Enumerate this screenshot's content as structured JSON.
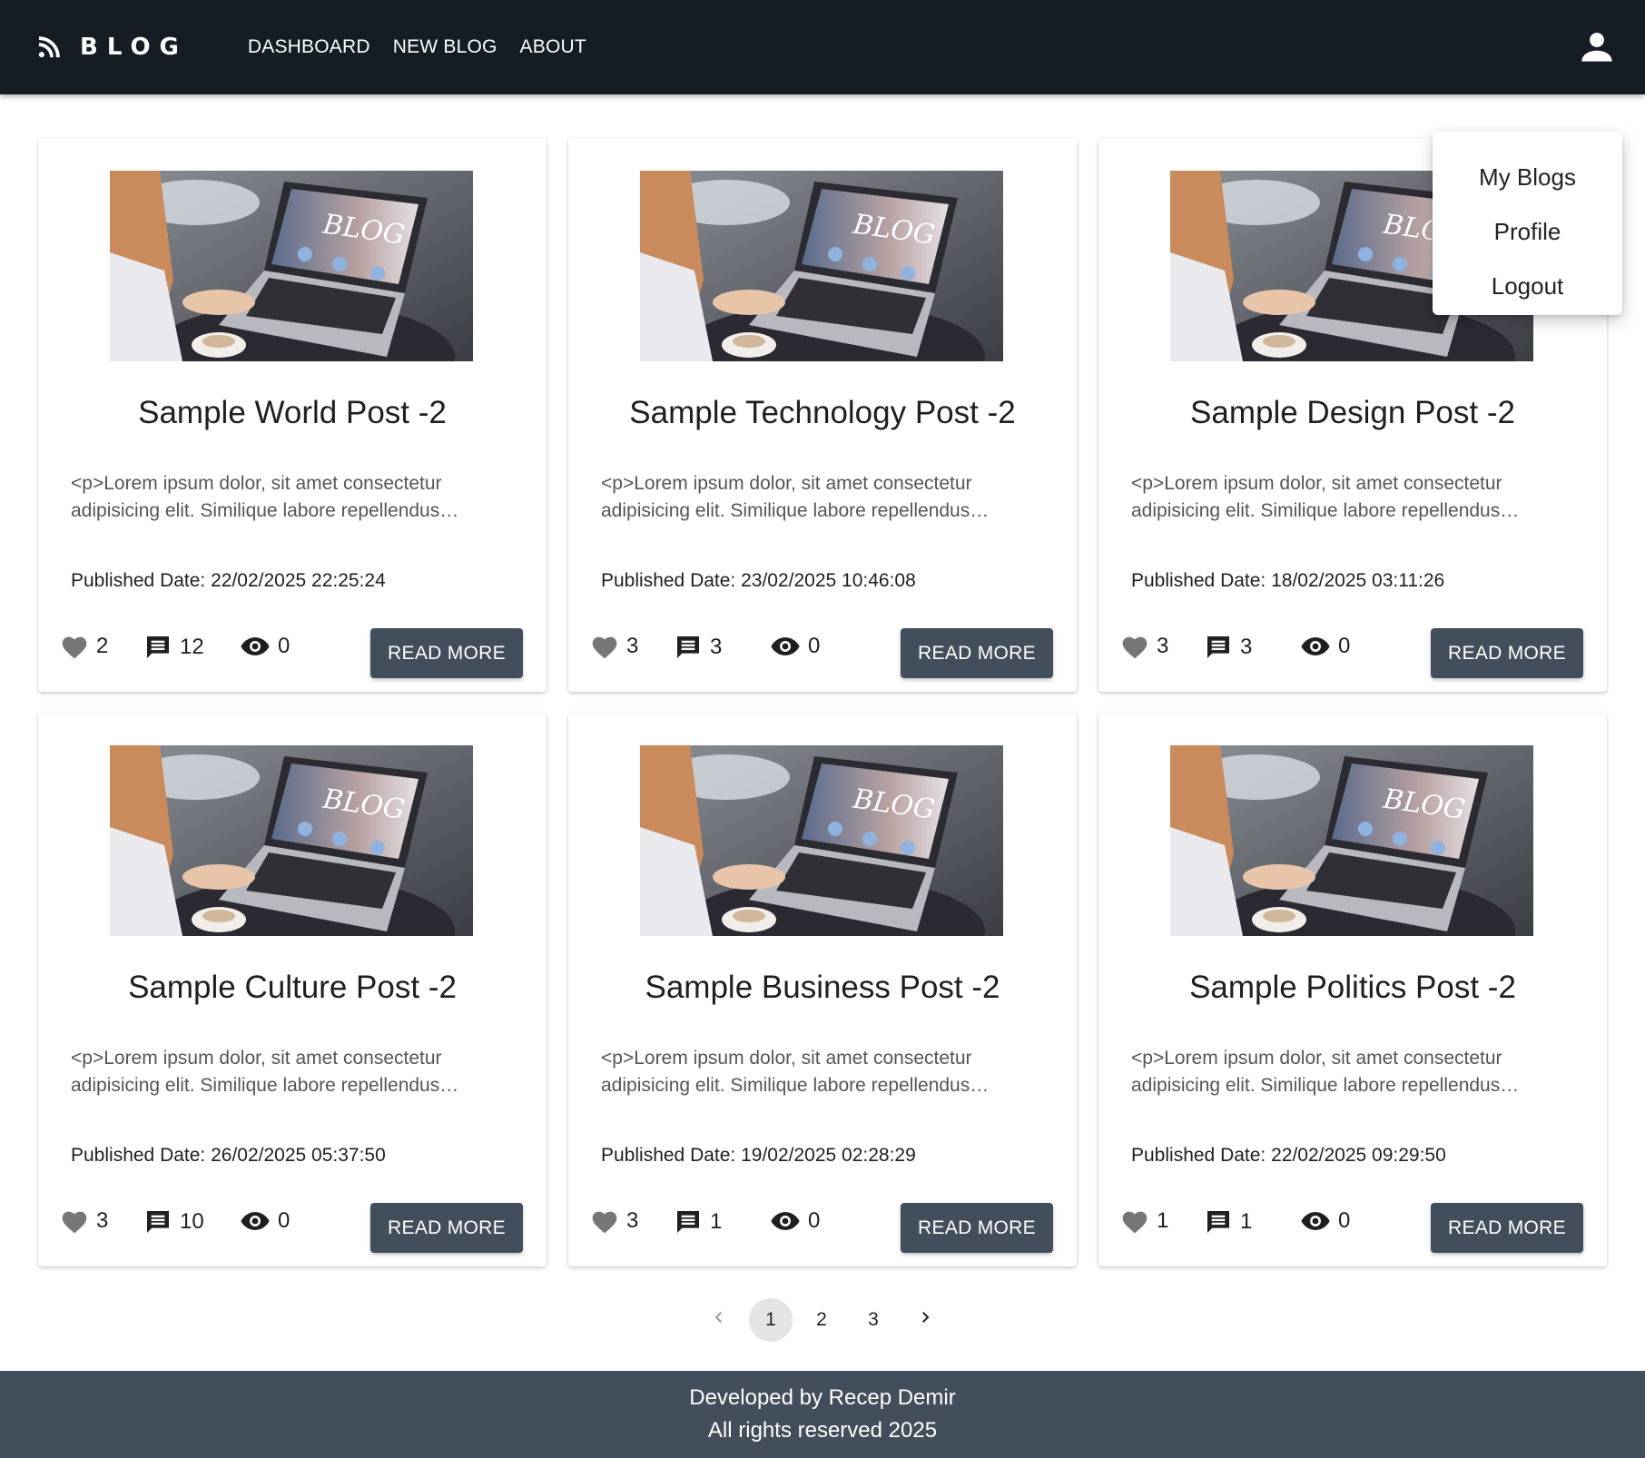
{
  "brand": {
    "name": "BLOG",
    "icon": "rss-icon"
  },
  "nav": {
    "links": [
      "DASHBOARD",
      "NEW BLOG",
      "ABOUT"
    ]
  },
  "user_menu": {
    "icon": "user-icon",
    "items": [
      "My Blogs",
      "Profile",
      "Logout"
    ]
  },
  "posts": [
    {
      "title": "Sample World Post -2",
      "excerpt": "<p>Lorem ipsum dolor, sit amet consectetur adipisicing elit. Similique labore repellendus…",
      "date": "Published Date: 22/02/2025 22:25:24",
      "likes": "2",
      "comments": "12",
      "views": "0",
      "button": "READ MORE"
    },
    {
      "title": "Sample Technology Post -2",
      "excerpt": "<p>Lorem ipsum dolor, sit amet consectetur adipisicing elit. Similique labore repellendus…",
      "date": "Published Date: 23/02/2025 10:46:08",
      "likes": "3",
      "comments": "3",
      "views": "0",
      "button": "READ MORE"
    },
    {
      "title": "Sample Design Post -2",
      "excerpt": "<p>Lorem ipsum dolor, sit amet consectetur adipisicing elit. Similique labore repellendus…",
      "date": "Published Date: 18/02/2025 03:11:26",
      "likes": "3",
      "comments": "3",
      "views": "0",
      "button": "READ MORE"
    },
    {
      "title": "Sample Culture Post -2",
      "excerpt": "<p>Lorem ipsum dolor, sit amet consectetur adipisicing elit. Similique labore repellendus…",
      "date": "Published Date: 26/02/2025 05:37:50",
      "likes": "3",
      "comments": "10",
      "views": "0",
      "button": "READ MORE"
    },
    {
      "title": "Sample Business Post -2",
      "excerpt": "<p>Lorem ipsum dolor, sit amet consectetur adipisicing elit. Similique labore repellendus…",
      "date": "Published Date: 19/02/2025 02:28:29",
      "likes": "3",
      "comments": "1",
      "views": "0",
      "button": "READ MORE"
    },
    {
      "title": "Sample Politics Post -2",
      "excerpt": "<p>Lorem ipsum dolor, sit amet consectetur adipisicing elit. Similique labore repellendus…",
      "date": "Published Date: 22/02/2025 09:29:50",
      "likes": "1",
      "comments": "1",
      "views": "0",
      "button": "READ MORE"
    }
  ],
  "image_text": "BLOG",
  "pagination": {
    "pages": [
      "1",
      "2",
      "3"
    ],
    "current": "1"
  },
  "footer": {
    "line1": "Developed by Recep Demir",
    "line2": "All rights reserved 2025"
  },
  "colors": {
    "navbar": "#161c24",
    "button": "#434e5d",
    "footer": "#434e5d",
    "icon_grey": "#767676"
  }
}
